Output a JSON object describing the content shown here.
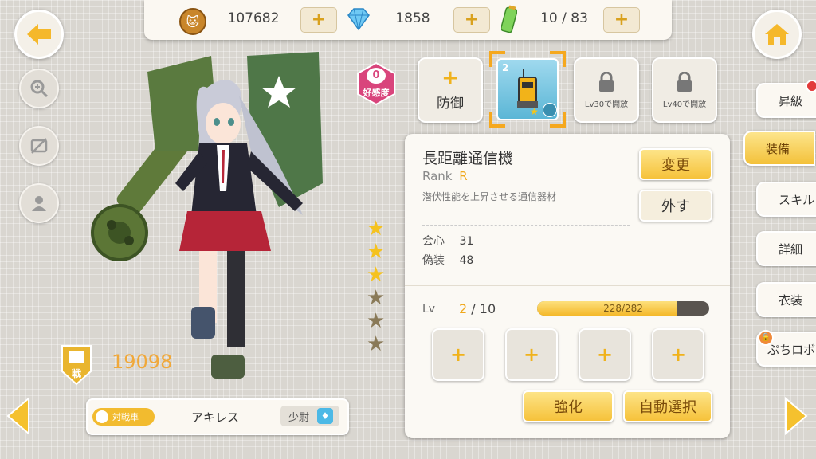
{
  "resources": {
    "coins": "107682",
    "gems": "1858",
    "stamina": "10 / 83"
  },
  "affection": {
    "value": "0",
    "label": "好感度"
  },
  "equip_slots": [
    {
      "label": "防御"
    },
    {
      "level": "2"
    },
    {
      "label": "Lv30で開放"
    },
    {
      "label": "Lv40で開放"
    }
  ],
  "item": {
    "name": "長距離通信機",
    "rank_label": "Rank",
    "rank_value": "R",
    "description": "潜伏性能を上昇させる通信器材",
    "stats": [
      {
        "name": "会心",
        "value": "31"
      },
      {
        "name": "偽装",
        "value": "48"
      }
    ],
    "lv_label": "Lv",
    "lv_current": "2",
    "lv_max": "/ 10",
    "exp_text": "228/282",
    "exp_fraction": 0.81
  },
  "buttons": {
    "change": "変更",
    "remove": "外す",
    "enhance": "強化",
    "auto_select": "自動選択"
  },
  "empty_slot_symbol": "+",
  "tabs": [
    {
      "label": "昇級"
    },
    {
      "label": "装備"
    },
    {
      "label": "スキル"
    },
    {
      "label": "詳細"
    },
    {
      "label": "衣装"
    },
    {
      "label": "ぷちロボ"
    }
  ],
  "character": {
    "power_label": "戦",
    "power": "19098",
    "type": "対戦車",
    "name": "アキレス",
    "rank": "少尉"
  },
  "stars": {
    "filled": 3,
    "total": 6
  },
  "colors": {
    "accent": "#f3c13a",
    "panel": "#fbf9f4",
    "affection": "#d9457c"
  },
  "icons": [
    "back-arrow-icon",
    "home-icon",
    "zoom-icon",
    "hide-ui-icon",
    "profile-icon",
    "coin-icon",
    "gem-icon",
    "battery-icon",
    "lock-icon"
  ]
}
